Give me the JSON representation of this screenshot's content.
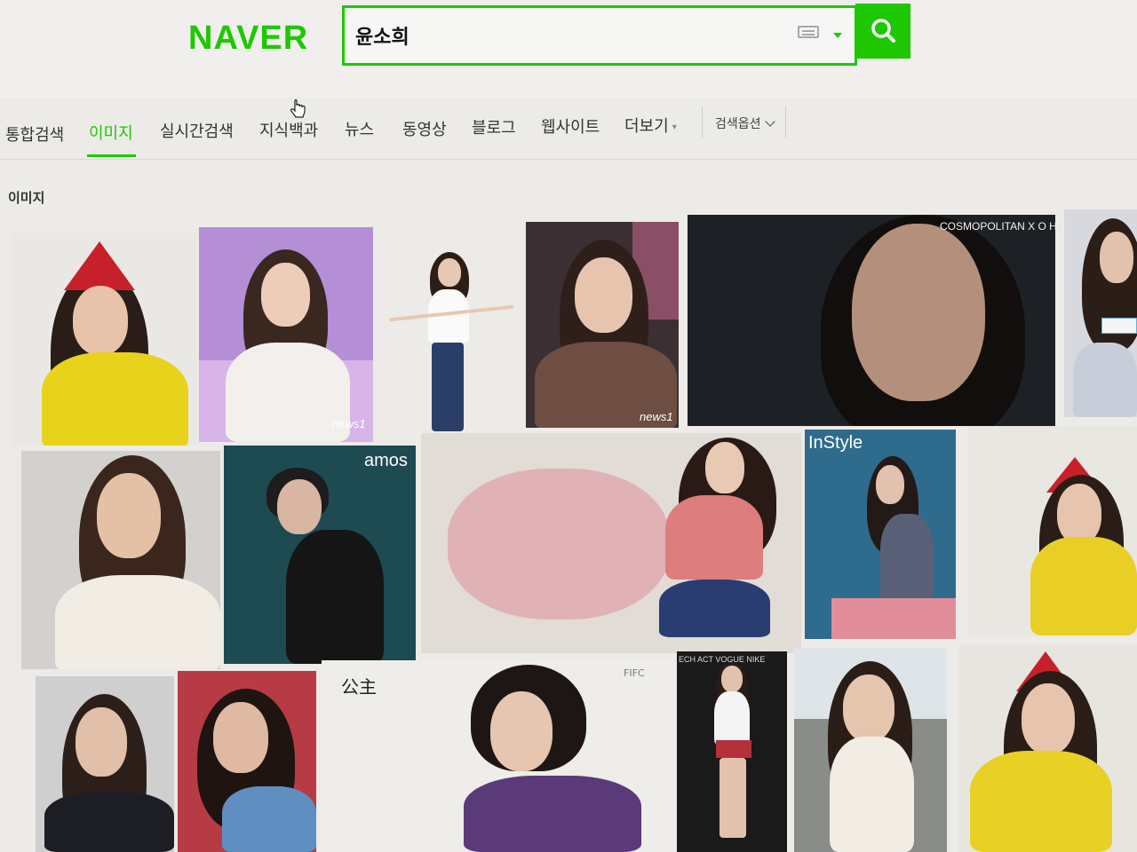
{
  "header": {
    "logo": "NAVER",
    "search_value": "윤소희",
    "brand_color": "#1ec800"
  },
  "tabs": [
    {
      "label": "통합검색",
      "active": false
    },
    {
      "label": "이미지",
      "active": true
    },
    {
      "label": "실시간검색",
      "active": false
    },
    {
      "label": "지식백과",
      "active": false
    },
    {
      "label": "뉴스",
      "active": false
    },
    {
      "label": "동영상",
      "active": false
    },
    {
      "label": "블로그",
      "active": false
    },
    {
      "label": "웹사이트",
      "active": false
    },
    {
      "label": "더보기",
      "active": false
    }
  ],
  "search_options_label": "검색옵션",
  "section_title": "이미지",
  "images": [
    {
      "overlay": ""
    },
    {
      "overlay": "news1"
    },
    {
      "overlay": ""
    },
    {
      "overlay": "news1"
    },
    {
      "overlay": "COSMOPOLITAN  X  O HUI"
    },
    {
      "overlay": ""
    },
    {
      "overlay": ""
    },
    {
      "overlay": "amos"
    },
    {
      "overlay": ""
    },
    {
      "overlay": "InStyle"
    },
    {
      "overlay": ""
    },
    {
      "overlay": ""
    },
    {
      "overlay": ""
    },
    {
      "overlay": ""
    },
    {
      "overlay": "FIFC"
    },
    {
      "overlay": "ECH ACT VOGUE NIKE"
    },
    {
      "overlay": ""
    },
    {
      "overlay": ""
    }
  ],
  "icons": [
    "search-icon",
    "keyboard-icon",
    "dropdown-arrow-icon",
    "chevron-down-icon",
    "hand-cursor-icon"
  ]
}
